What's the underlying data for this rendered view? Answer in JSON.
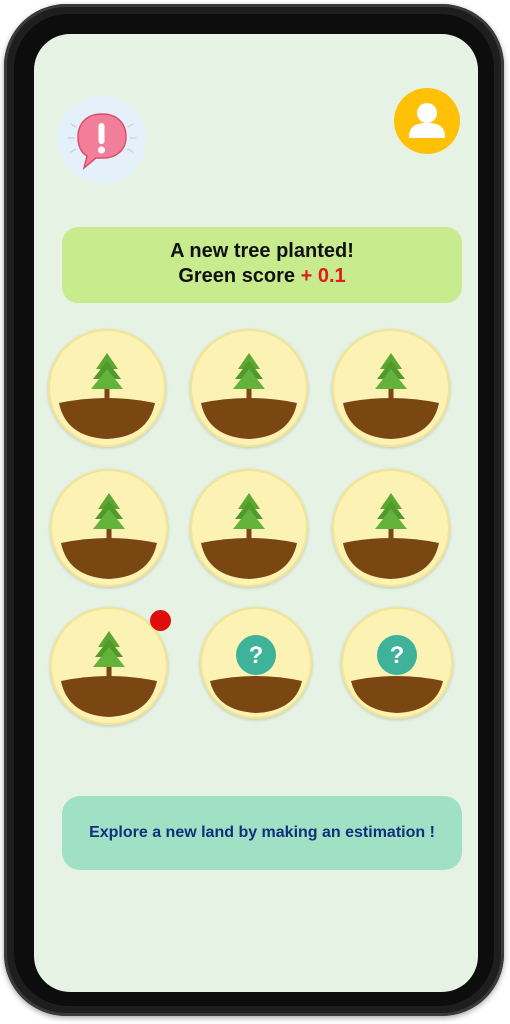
{
  "header": {
    "alert_icon": "exclamation-chat-bubble-icon",
    "profile_icon": "user-avatar-icon"
  },
  "banner": {
    "line1": "A new tree planted!",
    "line2_prefix": "Green score ",
    "line2_delta": "+ 0.1"
  },
  "lands": [
    {
      "state": "planted",
      "icon": "pine-tree-icon"
    },
    {
      "state": "planted",
      "icon": "pine-tree-icon"
    },
    {
      "state": "planted",
      "icon": "pine-tree-icon"
    },
    {
      "state": "planted",
      "icon": "pine-tree-icon"
    },
    {
      "state": "planted",
      "icon": "pine-tree-icon"
    },
    {
      "state": "planted",
      "icon": "pine-tree-icon"
    },
    {
      "state": "planted",
      "icon": "pine-tree-icon",
      "new": true
    },
    {
      "state": "unexplored",
      "icon": "question-mark-icon",
      "label": "?"
    },
    {
      "state": "unexplored",
      "icon": "question-mark-icon",
      "label": "?"
    }
  ],
  "explore": {
    "label": "Explore a new land by making an estimation !"
  },
  "colors": {
    "screen_bg": "#e6f3e4",
    "banner_bg": "#c8eb8e",
    "score_delta": "#e21b1b",
    "land_bg": "#fbf2b4",
    "soil": "#7a4612",
    "tree": "#4f9a2a",
    "question_badge": "#3fb39a",
    "explore_bg": "#a0e0c4",
    "explore_text": "#12307a",
    "profile_bg": "#ffc107",
    "new_dot": "#e10c0c"
  }
}
